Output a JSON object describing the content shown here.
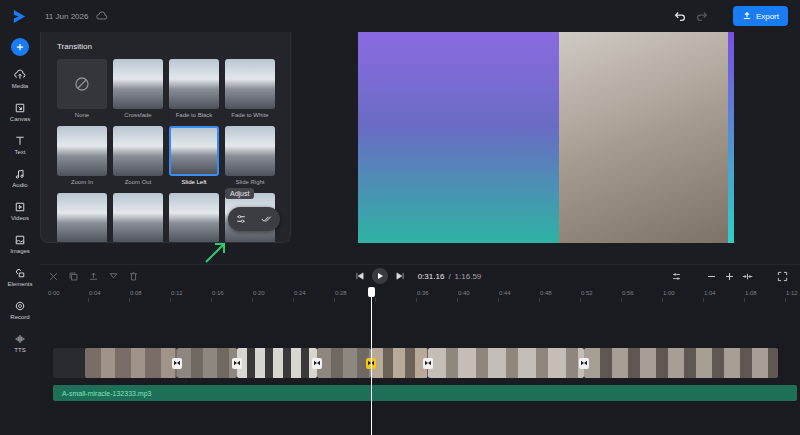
{
  "app": {
    "date": "11 Jun 2026",
    "export": "Export"
  },
  "sidebar": {
    "items": [
      {
        "label": "Media"
      },
      {
        "label": "Canvas"
      },
      {
        "label": "Text"
      },
      {
        "label": "Audio"
      },
      {
        "label": "Videos"
      },
      {
        "label": "Images"
      },
      {
        "label": "Elements"
      },
      {
        "label": "Record"
      },
      {
        "label": "TTS"
      }
    ]
  },
  "transition_panel": {
    "title": "Transition",
    "options": [
      {
        "label": "None",
        "kind": "none",
        "selected": false
      },
      {
        "label": "Crossfade",
        "kind": "preset",
        "selected": false
      },
      {
        "label": "Fade to Black",
        "kind": "preset",
        "selected": false
      },
      {
        "label": "Fade to White",
        "kind": "preset",
        "selected": false
      },
      {
        "label": "Zoom In",
        "kind": "preset",
        "selected": false
      },
      {
        "label": "Zoom Out",
        "kind": "preset",
        "selected": false
      },
      {
        "label": "Slide Left",
        "kind": "preset",
        "selected": true
      },
      {
        "label": "Slide Right",
        "kind": "preset",
        "selected": false
      },
      {
        "label": "",
        "kind": "preset",
        "selected": false
      },
      {
        "label": "",
        "kind": "preset",
        "selected": false
      },
      {
        "label": "",
        "kind": "preset",
        "selected": false
      },
      {
        "label": "",
        "kind": "preset",
        "selected": false
      }
    ],
    "tooltip": "Adjust"
  },
  "player": {
    "time": "0:31.16",
    "separator": "/",
    "duration": "1:16.59"
  },
  "ruler": [
    "0:00",
    "0:04",
    "0:08",
    "0:12",
    "0:16",
    "0:20",
    "0:24",
    "0:28",
    "0:36",
    "0:40",
    "0:44",
    "0:48",
    "0:52",
    "0:56",
    "1:00",
    "1:04",
    "1:08",
    "1:12"
  ],
  "timeline": {
    "transitions": [
      {
        "selected": false
      },
      {
        "selected": false
      },
      {
        "selected": false
      },
      {
        "selected": true
      },
      {
        "selected": false
      },
      {
        "selected": false
      }
    ],
    "audio": {
      "name": "A-small-miracle-132333.mp3"
    }
  }
}
